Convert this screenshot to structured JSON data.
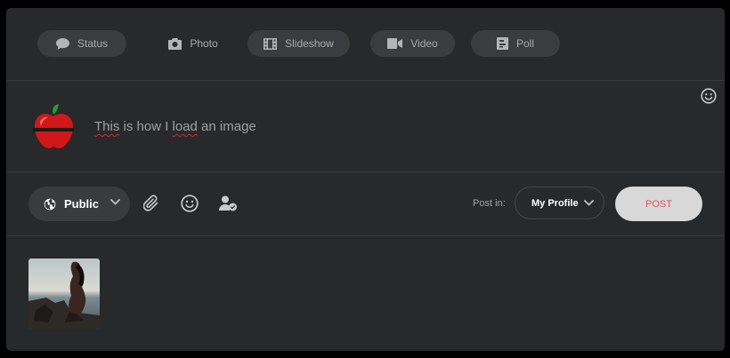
{
  "tabs": [
    {
      "label": "Status",
      "icon": "chat-bubble-icon"
    },
    {
      "label": "Photo",
      "icon": "camera-icon"
    },
    {
      "label": "Slideshow",
      "icon": "film-icon"
    },
    {
      "label": "Video",
      "icon": "video-camera-icon"
    },
    {
      "label": "Poll",
      "icon": "poll-icon"
    }
  ],
  "composer": {
    "text_part1": "This",
    "text_part2": " is how I ",
    "text_part3": "load",
    "text_part4": " an image"
  },
  "toolbar": {
    "privacy_label": "Public",
    "post_in_label": "Post in:",
    "profile_select_value": "My Profile",
    "post_button_label": "POST"
  },
  "colors": {
    "card_bg": "#27292b",
    "pill_bg": "#3a3c3f",
    "post_text": "#e0525a"
  }
}
